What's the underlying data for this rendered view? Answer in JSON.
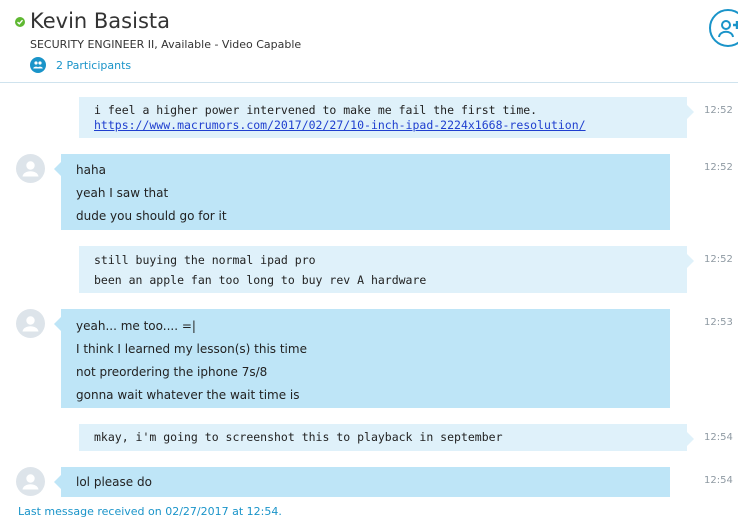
{
  "header": {
    "contact_name": "Kevin Basista",
    "subtitle": "SECURITY ENGINEER II,  Available - Video Capable",
    "participants_label": "2 Participants",
    "status_color": "#5fb832",
    "status_icon": "check-icon",
    "participants_icon": "people-icon",
    "add_button_icon": "add-person-icon"
  },
  "messages": [
    {
      "sender": "self",
      "lines": [
        "i feel a higher power intervened to make me fail the first time."
      ],
      "link": "https://www.macrumors.com/2017/02/27/10-inch-ipad-2224x1668-resolution/",
      "time": "12:52"
    },
    {
      "sender": "contact",
      "lines": [
        "haha",
        "yeah I saw that",
        "dude you should go for it"
      ],
      "time": "12:52"
    },
    {
      "sender": "self",
      "lines": [
        "still buying the normal ipad pro",
        "been an apple fan too long to buy rev A hardware"
      ],
      "time": "12:52"
    },
    {
      "sender": "contact",
      "lines": [
        "yeah... me too.... =|",
        "I think I learned my lesson(s) this time",
        "not preordering the iphone 7s/8",
        "gonna wait whatever the wait time is"
      ],
      "time": "12:53"
    },
    {
      "sender": "self",
      "lines": [
        "mkay, i'm going to screenshot this to playback in september"
      ],
      "time": "12:54"
    },
    {
      "sender": "contact",
      "lines": [
        "lol please do"
      ],
      "time": "12:54"
    }
  ],
  "footer": {
    "last_message": "Last message received on 02/27/2017 at 12:54."
  },
  "colors": {
    "accent": "#1a94c9",
    "self_bubble": "#dff1fa",
    "contact_bubble": "#bee5f7",
    "link": "#1f3fcf"
  }
}
